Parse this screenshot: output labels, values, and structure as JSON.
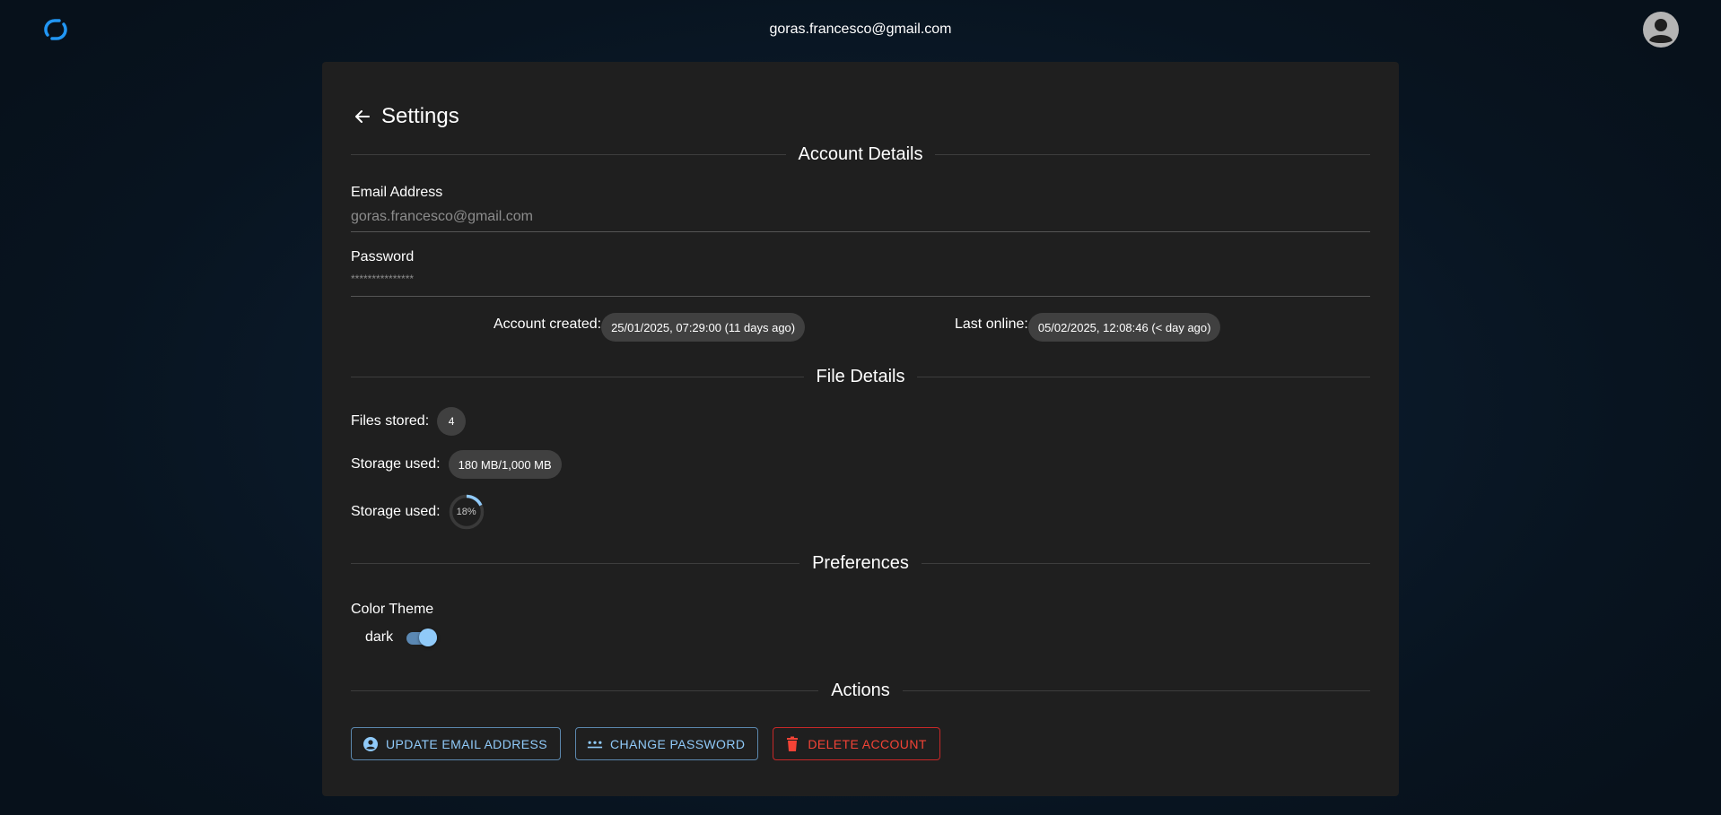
{
  "topbar": {
    "user_email": "goras.francesco@gmail.com",
    "logo_icon": "app-logo-icon",
    "avatar_icon": "account-circle-icon"
  },
  "settings": {
    "title": "Settings",
    "back_icon": "arrow-left-icon",
    "sections": {
      "account": "Account Details",
      "files": "File Details",
      "preferences": "Preferences",
      "actions": "Actions"
    },
    "email": {
      "label": "Email Address",
      "value": "goras.francesco@gmail.com"
    },
    "password": {
      "label": "Password",
      "value": "***************"
    },
    "account_created": {
      "label": "Account created:",
      "value": "25/01/2025, 07:29:00 (11 days ago)"
    },
    "last_online": {
      "label": "Last online:",
      "value": "05/02/2025, 12:08:46 (< day ago)"
    },
    "files_stored": {
      "label": "Files stored:",
      "value": "4"
    },
    "storage_used": {
      "label": "Storage used:",
      "value": "180 MB/1,000 MB"
    },
    "storage_progress": {
      "label": "Storage used:",
      "value": "18%",
      "fraction": 0.18
    },
    "color_theme": {
      "label": "Color Theme",
      "toggle_label": "dark",
      "enabled": true
    },
    "buttons": {
      "update_email": "UPDATE EMAIL ADDRESS",
      "change_password": "CHANGE PASSWORD",
      "delete_account": "DELETE ACCOUNT"
    }
  },
  "colors": {
    "accent": "#90caf9",
    "danger": "#f44336",
    "card": "#1f1f1f",
    "chip": "#404040"
  }
}
